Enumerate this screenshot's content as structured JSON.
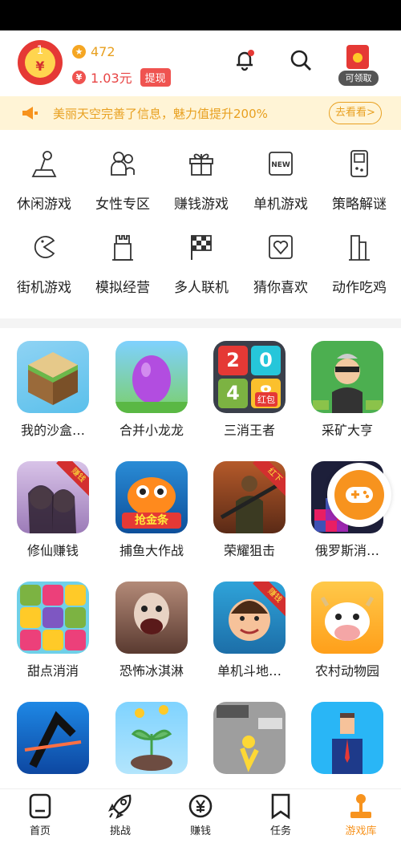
{
  "header": {
    "avatar_number": "1",
    "avatar_symbol": "¥",
    "coins": "472",
    "cash": "1.03元",
    "withdraw_label": "提现",
    "redpack_label": "可领取"
  },
  "notice": {
    "text": "美丽天空完善了信息，魅力值提升200%",
    "button": "去看看>"
  },
  "categories": [
    {
      "label": "休闲游戏",
      "icon": "joystick-icon"
    },
    {
      "label": "女性专区",
      "icon": "women-icon"
    },
    {
      "label": "赚钱游戏",
      "icon": "gift-icon"
    },
    {
      "label": "单机游戏",
      "icon": "new-icon"
    },
    {
      "label": "策略解谜",
      "icon": "gameboy-icon"
    },
    {
      "label": "街机游戏",
      "icon": "pacman-icon"
    },
    {
      "label": "模拟经营",
      "icon": "castle-icon"
    },
    {
      "label": "多人联机",
      "icon": "flag-icon"
    },
    {
      "label": "猜你喜欢",
      "icon": "heart-icon"
    },
    {
      "label": "动作吃鸡",
      "icon": "building-icon"
    }
  ],
  "games": [
    {
      "name": "我的沙盒…"
    },
    {
      "name": "合并小龙龙"
    },
    {
      "name": "三消王者",
      "tiles": [
        "2",
        "0",
        "4",
        "8"
      ],
      "tag": "红包"
    },
    {
      "name": "采矿大亨"
    },
    {
      "name": "修仙赚钱",
      "badge": "赚钱"
    },
    {
      "name": "捕鱼大作战",
      "caption": "抢金条"
    },
    {
      "name": "荣耀狙击",
      "badge": "红下"
    },
    {
      "name": "俄罗斯消…"
    },
    {
      "name": "甜点消消"
    },
    {
      "name": "恐怖冰淇淋"
    },
    {
      "name": "单机斗地…",
      "badge": "赚钱"
    },
    {
      "name": "农村动物园"
    },
    {
      "name": ""
    },
    {
      "name": ""
    },
    {
      "name": ""
    },
    {
      "name": ""
    }
  ],
  "tabs": [
    {
      "label": "首页",
      "icon": "home-icon"
    },
    {
      "label": "挑战",
      "icon": "rocket-icon"
    },
    {
      "label": "赚钱",
      "icon": "yen-icon"
    },
    {
      "label": "任务",
      "icon": "bookmark-icon"
    },
    {
      "label": "游戏库",
      "icon": "joystick-icon",
      "active": true
    }
  ],
  "colors": {
    "accent": "#f7931e",
    "red": "#e53935",
    "gold": "#e8a020"
  }
}
